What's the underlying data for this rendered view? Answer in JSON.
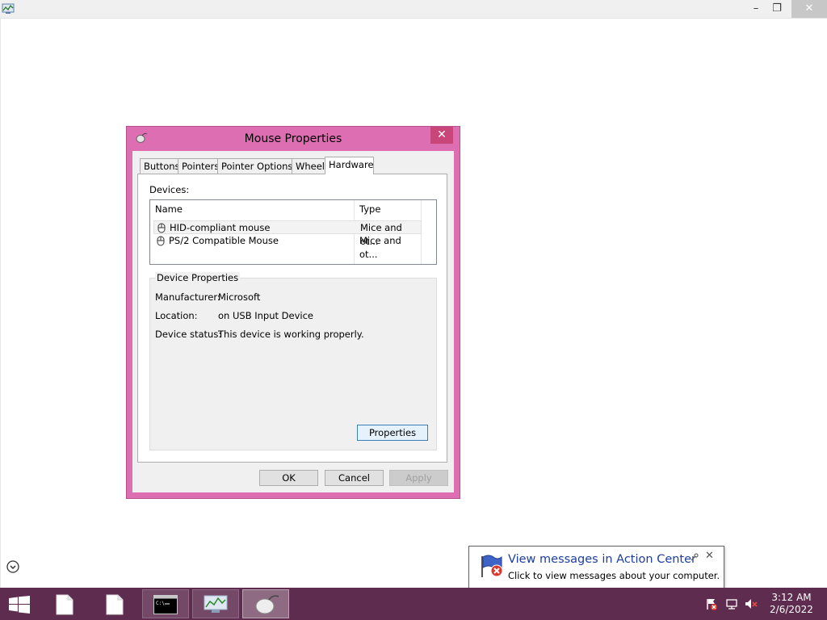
{
  "app_bar": {
    "icon": "performance-monitor-icon",
    "minimize": "–",
    "restore": "❐",
    "close": "✕"
  },
  "dialog": {
    "title": "Mouse Properties",
    "close_glyph": "✕",
    "title_icon": "mouse-icon",
    "tabs": [
      {
        "label": "Buttons",
        "active": false
      },
      {
        "label": "Pointers",
        "active": false
      },
      {
        "label": "Pointer Options",
        "active": false
      },
      {
        "label": "Wheel",
        "active": false
      },
      {
        "label": "Hardware",
        "active": true
      }
    ],
    "devices_label": "Devices:",
    "columns": [
      "Name",
      "Type"
    ],
    "devices": [
      {
        "name": "HID-compliant mouse",
        "type": "Mice and ot...",
        "selected": true
      },
      {
        "name": "PS/2 Compatible Mouse",
        "type": "Mice and ot...",
        "selected": false
      }
    ],
    "device_properties": {
      "title": "Device Properties",
      "manufacturer_label": "Manufacturer:",
      "manufacturer": "Microsoft",
      "location_label": "Location:",
      "location": "on USB Input Device",
      "status_label": "Device status:",
      "status": "This device is working properly.",
      "properties_button": "Properties"
    },
    "buttons": {
      "ok": "OK",
      "cancel": "Cancel",
      "apply": "Apply"
    },
    "border_color": "#dc6eb1"
  },
  "notification": {
    "icon": "action-center-flag-icon",
    "title": "View messages in Action Center",
    "body": "Click to view messages about your computer.",
    "close_glyph": "✕"
  },
  "taskbar": {
    "color": "#5e2c4e",
    "items": [
      {
        "name": "start-button",
        "icon": "windows-logo-icon"
      },
      {
        "name": "taskbar-file-1",
        "icon": "file-icon"
      },
      {
        "name": "taskbar-file-2",
        "icon": "file-icon"
      },
      {
        "name": "taskbar-command-prompt",
        "icon": "command-prompt-icon"
      },
      {
        "name": "taskbar-performance-monitor",
        "icon": "performance-monitor-icon"
      },
      {
        "name": "taskbar-mouse-properties",
        "icon": "mouse-icon"
      }
    ],
    "tray": [
      "action-center-error-icon",
      "network-icon",
      "volume-muted-icon"
    ],
    "time": "3:12 AM",
    "date": "2/6/2022"
  }
}
